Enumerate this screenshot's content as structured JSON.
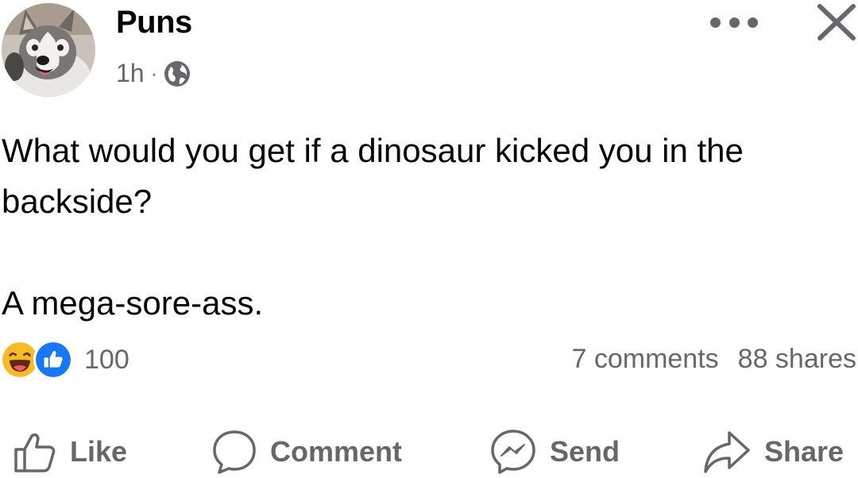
{
  "post": {
    "author": "Puns",
    "timestamp": "1h",
    "separator": "·",
    "privacy_icon": "globe-icon",
    "text_line_1": "What would you get if a dinosaur kicked you in the backside?",
    "text_line_2": "A mega-sore-ass."
  },
  "header_actions": {
    "more_icon": "more-horizontal-icon",
    "close_icon": "close-icon"
  },
  "reactions": {
    "types": [
      "haha",
      "like"
    ],
    "count": "100"
  },
  "engagement": {
    "comments": "7 comments",
    "shares": "88 shares"
  },
  "action_bar": [
    {
      "label": "Like",
      "icon": "thumbs-up-icon"
    },
    {
      "label": "Comment",
      "icon": "comment-bubble-icon"
    },
    {
      "label": "Send",
      "icon": "messenger-icon"
    },
    {
      "label": "Share",
      "icon": "share-arrow-icon"
    }
  ],
  "colors": {
    "secondary_text": "#65676b",
    "primary_text": "#050505",
    "like_blue": "#1877f2",
    "haha_yellow": "#f7b928"
  }
}
